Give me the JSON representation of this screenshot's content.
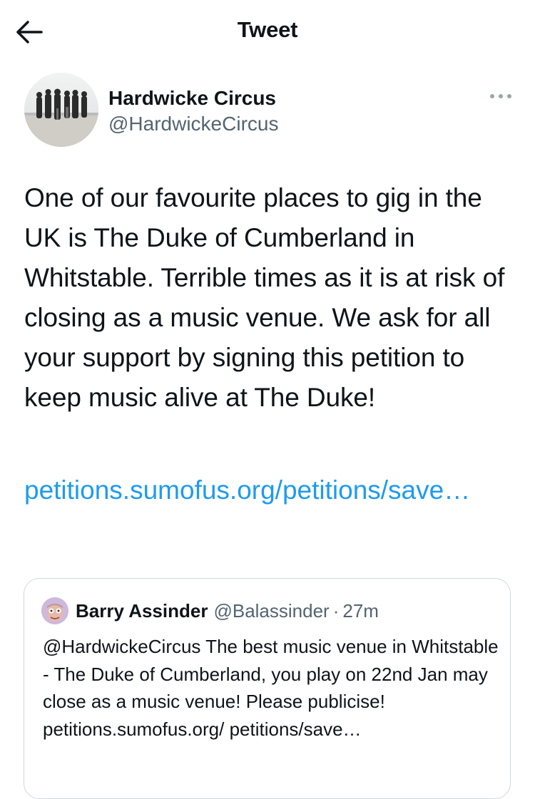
{
  "header": {
    "title": "Tweet",
    "back_icon": "arrow-left-icon"
  },
  "tweet": {
    "author": {
      "display_name": "Hardwicke Circus",
      "handle": "@HardwickeCircus"
    },
    "more_icon": "more-horizontal-icon",
    "text": "One of our favourite places to gig in the UK is The Duke of Cumberland in Whitstable. Terrible times as it is at risk of closing as a music venue. We ask for all your support by signing this petition to keep music alive at The Duke!",
    "link_text": "petitions.sumofus.org/petitions/save…"
  },
  "quoted_tweet": {
    "author": {
      "display_name": "Barry Assinder",
      "handle": "@Balassinder",
      "separator": "·",
      "time": "27m"
    },
    "text": "@HardwickeCircus The best music venue in Whitstable - The Duke of Cumberland, you play on 22nd Jan may close as a music venue! Please publicise! petitions.sumofus.org/ petitions/save…"
  },
  "colors": {
    "text_primary": "#0f1419",
    "text_secondary": "#536471",
    "link": "#1d9bf0",
    "border": "#cfd9de"
  }
}
